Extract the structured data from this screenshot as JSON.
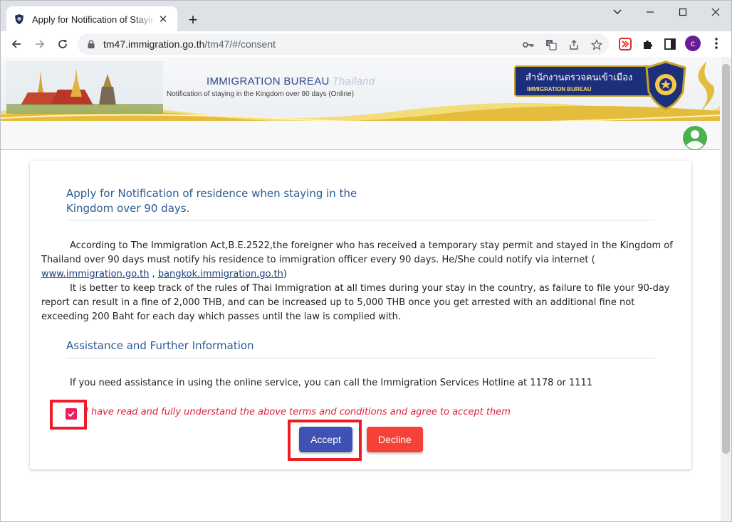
{
  "browser": {
    "tab_title": "Apply for Notification of Staying in the Kingdom",
    "tab_close": "✕",
    "new_tab": "+",
    "url_host": "tm47.immigration.go.th",
    "url_path": "/tm47/#/consent",
    "profile_initial": "c",
    "icons": [
      "back-icon",
      "forward-icon",
      "reload-icon",
      "lock-icon",
      "key-icon",
      "translate-icon",
      "share-icon",
      "star-icon",
      "extension-red-icon",
      "puzzle-icon",
      "sidepanel-icon",
      "menu-icon"
    ]
  },
  "banner": {
    "title_en": "IMMIGRATION BUREAU",
    "title_thai_word": "Thailand",
    "subtitle": "Notification of staying in the Kingdom over 90 days (Online)",
    "thai_name": "สำนักงานตรวจคนเข้าเมือง",
    "badge_en": "IMMIGRATION BUREAU"
  },
  "content": {
    "heading1": "Apply for Notification of residence when staying in the Kingdom over 90 days.",
    "para1": "According to The Immigration Act,B.E.2522,the foreigner who has received a temporary stay permit and stayed in the Kingdom of Thailand over 90 days must notify his residence to immigration officer every 90 days. He/She could notify via internet (",
    "link1": "www.immigration.go.th",
    "link_sep": " , ",
    "link2": "bangkok.immigration.go.th",
    "para1_end": ")",
    "para2": "It is better to keep track of the rules of Thai Immigration at all times during your stay in the country, as failure to file your 90-day report can result in a fine of 2,000 THB, and can be increased up to 5,000 THB once you get arrested with an additional fine not exceeding 200 Baht for each day which passes until the law is complied with.",
    "heading2": "Assistance and Further Information",
    "hotline": "If you need assistance in using the online service, you can call the Immigration Services Hotline at 1178 or 1111",
    "agree": "I have read and fully understand the above terms and conditions and agree to accept them",
    "agree_checked": true
  },
  "buttons": {
    "accept": "Accept",
    "decline": "Decline"
  },
  "colors": {
    "accept": "#3f51b5",
    "decline": "#f44336",
    "checkbox": "#e91e63",
    "highlight": "#ee1c25",
    "heading": "#2a5a93"
  }
}
